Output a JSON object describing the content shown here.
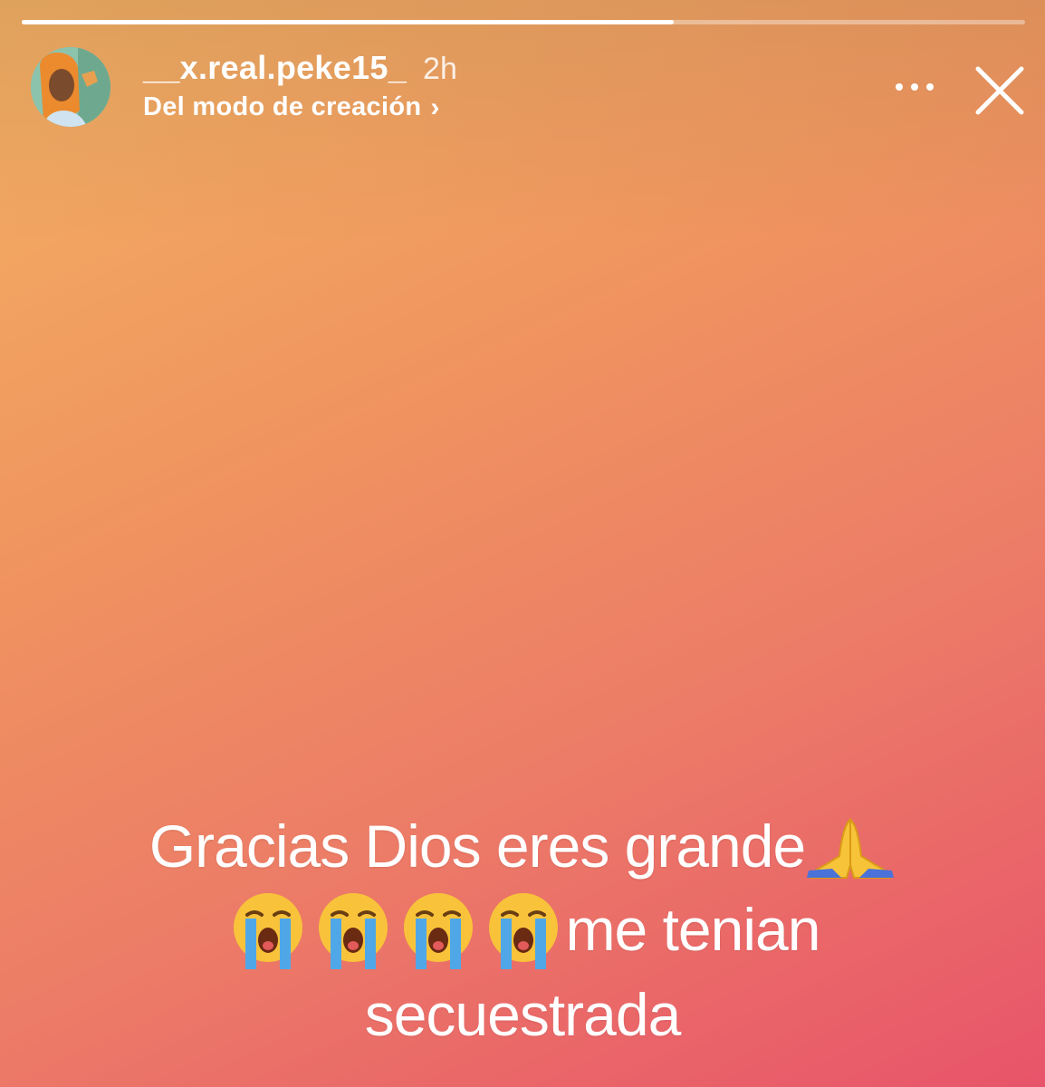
{
  "story": {
    "progress": 0.65,
    "gradient_colors": [
      "#f3b163",
      "#f0955f",
      "#ec7c67",
      "#e8546a"
    ]
  },
  "header": {
    "username": "__x.real.peke15_",
    "time": "2h",
    "subtitle": "Del modo de creación",
    "subtitle_icon": "chevron-right-icon",
    "more_icon": "more-horizontal-icon",
    "close_icon": "close-icon"
  },
  "caption": {
    "line1": "Gracias Dios eres grande",
    "line1_emoji": "folded-hands-emoji",
    "line2_emoji": "loudly-crying-face-emoji",
    "line2_emoji_count": 4,
    "line2": "me tenian",
    "line3": "secuestrada"
  }
}
